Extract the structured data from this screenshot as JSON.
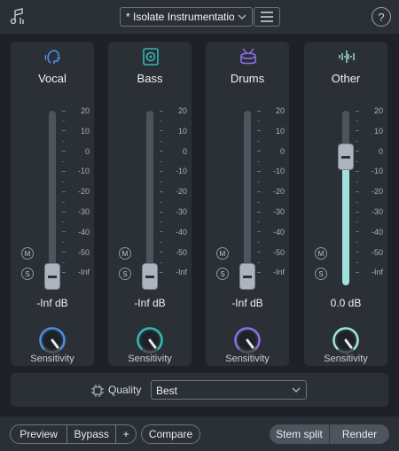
{
  "header": {
    "preset_name": "* Isolate Instrumentation",
    "help_label": "?"
  },
  "channels": [
    {
      "name": "Vocal",
      "readout": "-Inf dB",
      "sensitivity_label": "Sensitivity",
      "accent": "#4a8fe0",
      "level_db": "-Inf",
      "mute_label": "M",
      "solo_label": "S",
      "icon": "head-voice-icon"
    },
    {
      "name": "Bass",
      "readout": "-Inf dB",
      "sensitivity_label": "Sensitivity",
      "accent": "#2fb8b2",
      "level_db": "-Inf",
      "mute_label": "M",
      "solo_label": "S",
      "icon": "speaker-icon"
    },
    {
      "name": "Drums",
      "readout": "-Inf dB",
      "sensitivity_label": "Sensitivity",
      "accent": "#8a6fe0",
      "level_db": "-Inf",
      "mute_label": "M",
      "solo_label": "S",
      "icon": "drum-icon"
    },
    {
      "name": "Other",
      "readout": "0.0 dB",
      "sensitivity_label": "Sensitivity",
      "accent": "#9fe2dd",
      "level_db": "0",
      "mute_label": "M",
      "solo_label": "S",
      "icon": "waveform-icon"
    }
  ],
  "fader_scale": [
    "20",
    "10",
    "0",
    "-10",
    "-20",
    "-30",
    "-40",
    "-50",
    "-Inf"
  ],
  "quality": {
    "label": "Quality",
    "value": "Best"
  },
  "footer": {
    "preview_label": "Preview",
    "bypass_label": "Bypass",
    "plus_label": "+",
    "compare_label": "Compare",
    "stem_split_label": "Stem split",
    "render_label": "Render"
  }
}
